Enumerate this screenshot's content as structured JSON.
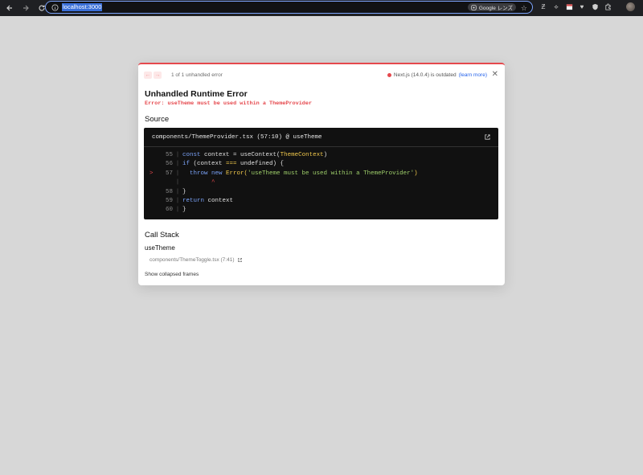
{
  "browser": {
    "url": "localhost:3000",
    "lens_label": "Google レンズ"
  },
  "overlay": {
    "error_count": "1 of 1 unhandled error",
    "version_text": "Next.js (14.0.4) is outdated",
    "learn_more": "(learn more)",
    "title": "Unhandled Runtime Error",
    "message": "Error: useTheme must be used within a ThemeProvider",
    "source_heading": "Source",
    "source_file": "components/ThemeProvider.tsx (57:10) @ useTheme",
    "code_lines": [
      {
        "marker": "",
        "num": "55"
      },
      {
        "marker": "",
        "num": "56"
      },
      {
        "marker": ">",
        "num": "57"
      },
      {
        "marker": "",
        "num": ""
      },
      {
        "marker": "",
        "num": "58"
      },
      {
        "marker": "",
        "num": "59"
      },
      {
        "marker": "",
        "num": "60"
      }
    ],
    "code_tokens": {
      "l55": [
        "const",
        " context ",
        "=",
        " useContext(",
        "ThemeContext",
        ")"
      ],
      "l56": [
        "if",
        " (context ",
        "===",
        " undefined) {"
      ],
      "l57": [
        "  throw",
        " new",
        " Error(",
        "'useTheme must be used within a ThemeProvider'",
        ")"
      ],
      "caret": "        ^",
      "l58": [
        "}"
      ],
      "l59": [
        "return",
        " context"
      ],
      "l60": [
        "}"
      ]
    },
    "callstack_heading": "Call Stack",
    "frame_name": "useTheme",
    "frame_file": "components/ThemeToggle.tsx (7:41)",
    "show_collapsed": "Show collapsed frames"
  },
  "colors": {
    "accent_error": "#e5484d",
    "link": "#2563eb",
    "code_bg": "#111111",
    "page_bg": "#d7d7d7"
  }
}
